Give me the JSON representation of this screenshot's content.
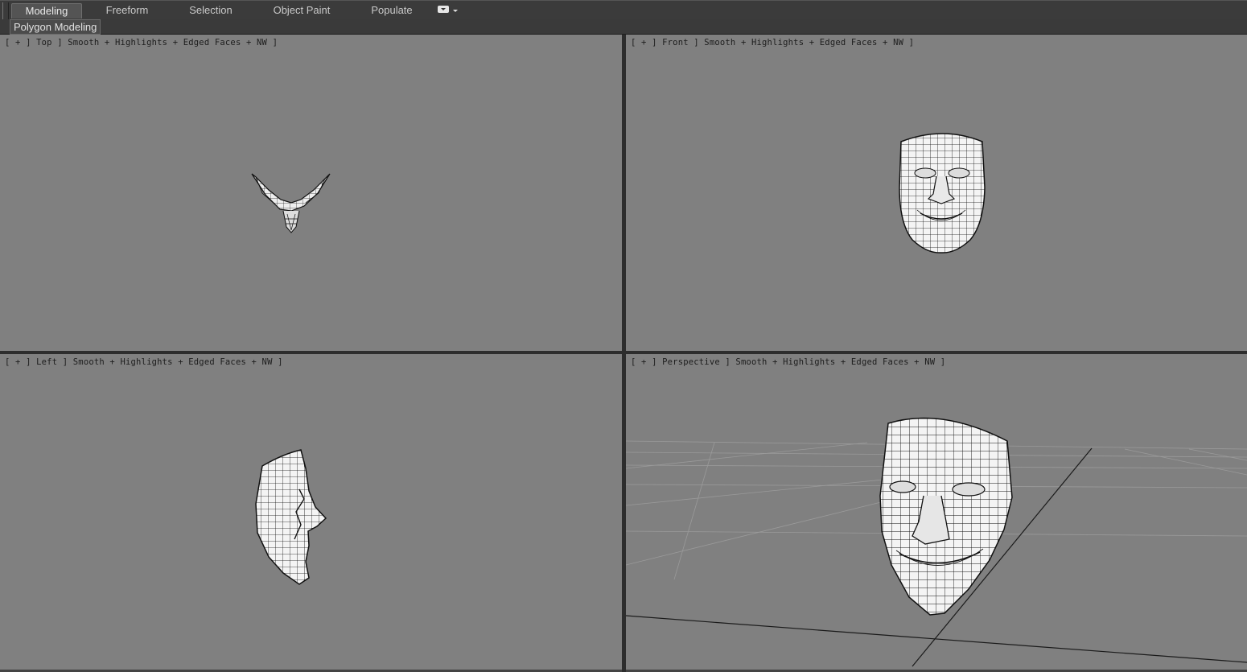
{
  "ribbon": {
    "tabs": [
      {
        "label": "Modeling",
        "active": true
      },
      {
        "label": "Freeform",
        "active": false
      },
      {
        "label": "Selection",
        "active": false
      },
      {
        "label": "Object Paint",
        "active": false
      },
      {
        "label": "Populate",
        "active": false
      }
    ],
    "panel_label": "Polygon Modeling"
  },
  "viewports": {
    "top": {
      "label": "[ + ] Top ] Smooth + Highlights + Edged Faces + NW ]"
    },
    "front": {
      "label": "[ + ] Front ] Smooth + Highlights + Edged Faces + NW ]"
    },
    "left": {
      "label": "[ + ] Left ] Smooth + Highlights + Edged Faces + NW ]"
    },
    "perspective": {
      "label": "[ + ] Perspective ] Smooth + Highlights + Edged Faces + NW ]"
    }
  },
  "colors": {
    "viewport_bg": "#808080",
    "ui_bg": "#3b3b3b",
    "mesh_fill": "#f2f2f2",
    "mesh_wire": "#111111"
  }
}
